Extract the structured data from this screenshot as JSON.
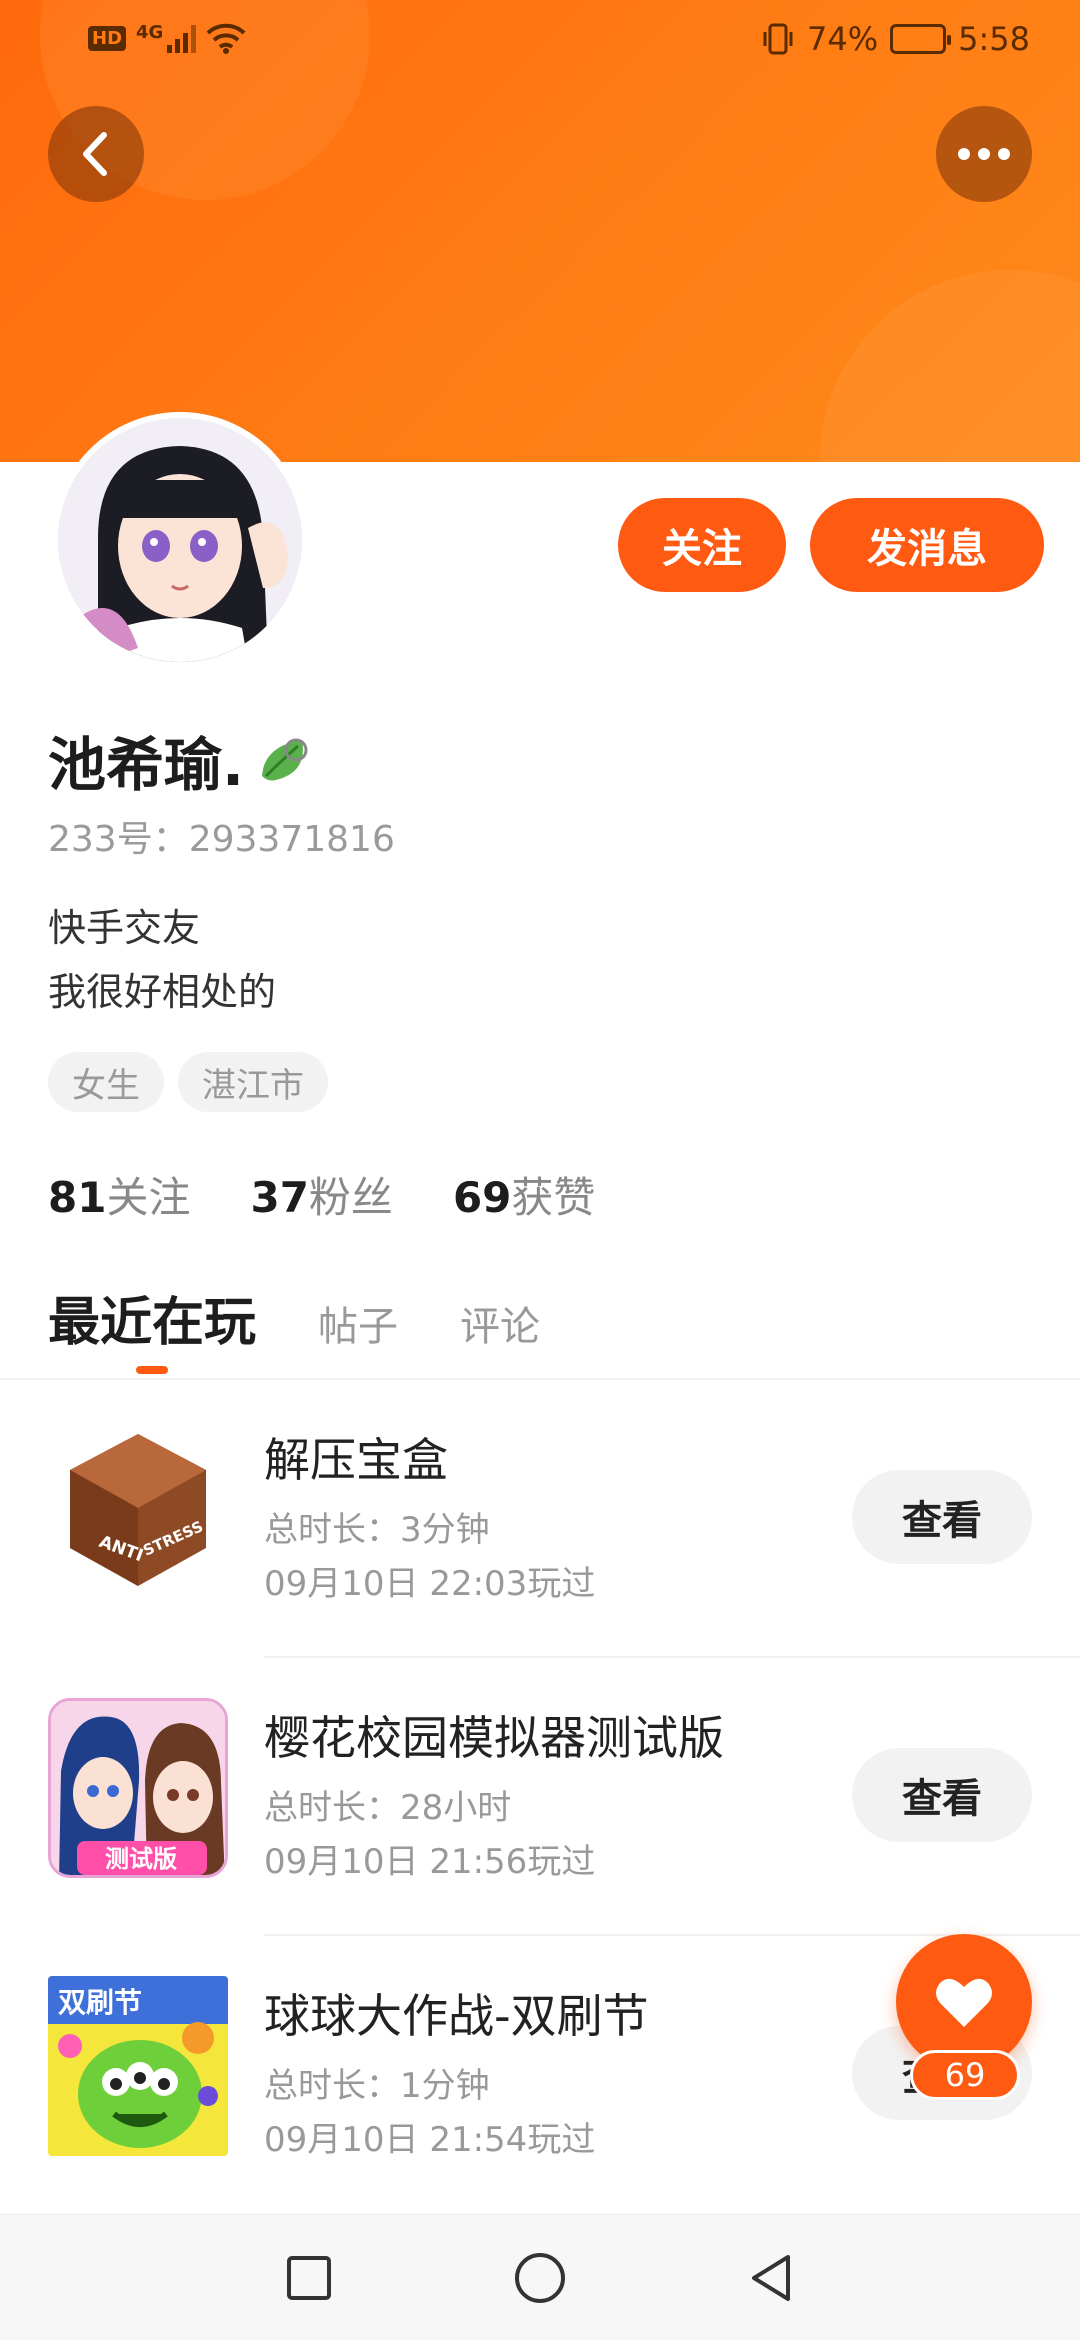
{
  "status_bar": {
    "hd": "HD",
    "network": "4G",
    "battery_percent": "74%",
    "battery_level": 0.74,
    "time": "5:58"
  },
  "header": {
    "back_icon": "chevron-left-icon",
    "more_icon": "more-dots-icon",
    "banner_color": "#ff7a12"
  },
  "profile": {
    "name": "池希瑜.",
    "uid": "233号：293371816",
    "bio_line1": "快手交友",
    "bio_line2": "我很好相处的",
    "tags": [
      "女生",
      "湛江市"
    ],
    "follow_label": "关注",
    "message_label": "发消息"
  },
  "stats": [
    {
      "value": "81",
      "label": "关注"
    },
    {
      "value": "37",
      "label": "粉丝"
    },
    {
      "value": "69",
      "label": "获赞"
    }
  ],
  "tabs": [
    {
      "label": "最近在玩",
      "active": true
    },
    {
      "label": "帖子",
      "active": false
    },
    {
      "label": "评论",
      "active": false
    }
  ],
  "games": [
    {
      "title": "解压宝盒",
      "duration": "总时长：3分钟",
      "last_played": "09月10日 22:03玩过",
      "button": "查看"
    },
    {
      "title": "樱花校园模拟器测试版",
      "duration": "总时长：28小时",
      "last_played": "09月10日 21:56玩过",
      "button": "查看"
    },
    {
      "title": "球球大作战-双刷节",
      "duration": "总时长：1分钟",
      "last_played": "09月10日 21:54玩过",
      "button": "查看"
    }
  ],
  "game_icon_text": {
    "anti": "ANTI",
    "stress": "STRESS",
    "beta": "测试版",
    "festival": "双刷节"
  },
  "like_fab": {
    "count": "69",
    "icon": "heart-icon"
  },
  "accent_color": "#ff5a12"
}
